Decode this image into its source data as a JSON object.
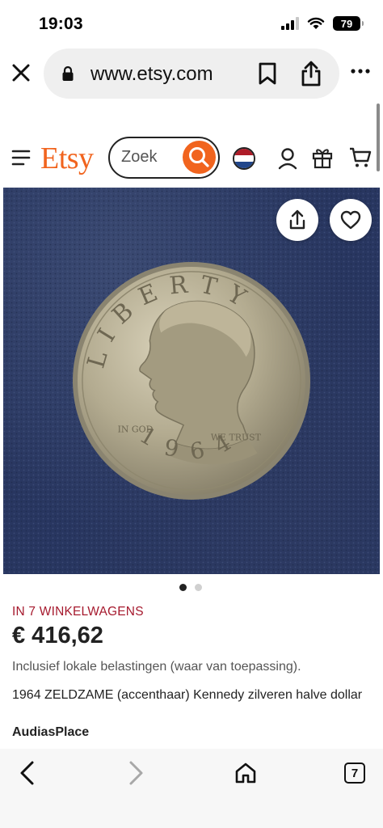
{
  "status_bar": {
    "time": "19:03",
    "battery": "79"
  },
  "browser": {
    "url": "www.etsy.com",
    "icons": [
      "close-icon",
      "lock-icon",
      "bookmark-icon",
      "share-icon",
      "more-icon"
    ]
  },
  "header": {
    "logo": "Etsy",
    "search_placeholder": "Zoek",
    "icons": [
      "menu-icon",
      "search-icon",
      "flag-icon",
      "user-icon",
      "gift-icon",
      "cart-icon"
    ]
  },
  "product_image": {
    "coin_text": {
      "liberty": "LIBERTY",
      "motto_left": "IN GOD",
      "motto_right": "WE TRUST",
      "year": "1964"
    },
    "current_image": 1,
    "image_count": 2
  },
  "product": {
    "cart_count": "IN 7 WINKELWAGENS",
    "price": "€ 416,62",
    "tax_note": "Inclusief lokale belastingen (waar van toepassing).",
    "title": "1964 ZELDZAME (accenthaar) Kennedy zilveren halve dollar",
    "shop": "AudiasPlace"
  },
  "toolbar": {
    "tab_count": "7"
  },
  "colors": {
    "brand": "#f1641e",
    "cart_count": "#a61a2e",
    "image_bg": "#283660"
  }
}
